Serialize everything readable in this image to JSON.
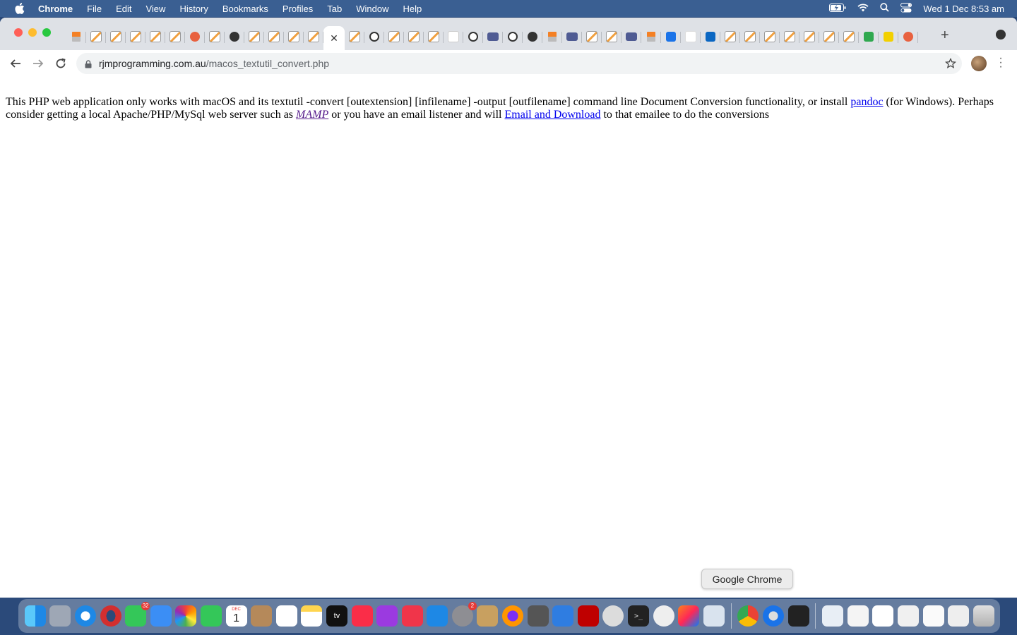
{
  "menubar": {
    "app_name": "Chrome",
    "items": [
      "File",
      "Edit",
      "View",
      "History",
      "Bookmarks",
      "Profiles",
      "Tab",
      "Window",
      "Help"
    ],
    "clock": "Wed 1 Dec  8:53 am"
  },
  "browser": {
    "url_host": "rjmprogramming.com.au",
    "url_path": "/macos_textutil_convert.php",
    "tab_favicons": [
      "so",
      "pencil",
      "pencil",
      "pencil",
      "pencil",
      "pencil",
      "red",
      "pencil",
      "dark",
      "pencil",
      "pencil",
      "pencil",
      "pencil",
      "close",
      "pencil",
      "gh",
      "pencil",
      "pencil",
      "pencil",
      "white",
      "gh",
      "php",
      "gh",
      "dark",
      "so",
      "php",
      "pencil",
      "pencil",
      "php",
      "so",
      "blue",
      "gmail",
      "li",
      "pencil",
      "pencil",
      "pencil",
      "pencil",
      "pencil",
      "pencil",
      "pencil",
      "green",
      "yellow",
      "red"
    ],
    "active_tab_index": 13,
    "active_tab_close_glyph": "✕"
  },
  "page": {
    "text_before_pandoc": "This PHP web application only works with macOS and its textutil -convert [outextension] [infilename] -output [outfilename] command line Document Conversion functionality, or install ",
    "pandoc_link": "pandoc",
    "text_after_pandoc": " (for Windows).  Perhaps consider getting a local Apache/PHP/MySql web server such as ",
    "mamp_link": "MAMP",
    "text_before_email": " or you have an email listener and will ",
    "email_link": "Email and Download",
    "text_after_email": " to that emailee to do the conversions"
  },
  "tooltip": "Google Chrome",
  "dock": {
    "calendar_month": "DEC",
    "calendar_day": "1",
    "messages_badge": "32",
    "settings_badge": "2",
    "tv_label": "tv",
    "terminal_label": ">_"
  },
  "colors": {
    "link": "#0000ee",
    "visited_link": "#551a8b",
    "menubar": "#3a5f92"
  }
}
